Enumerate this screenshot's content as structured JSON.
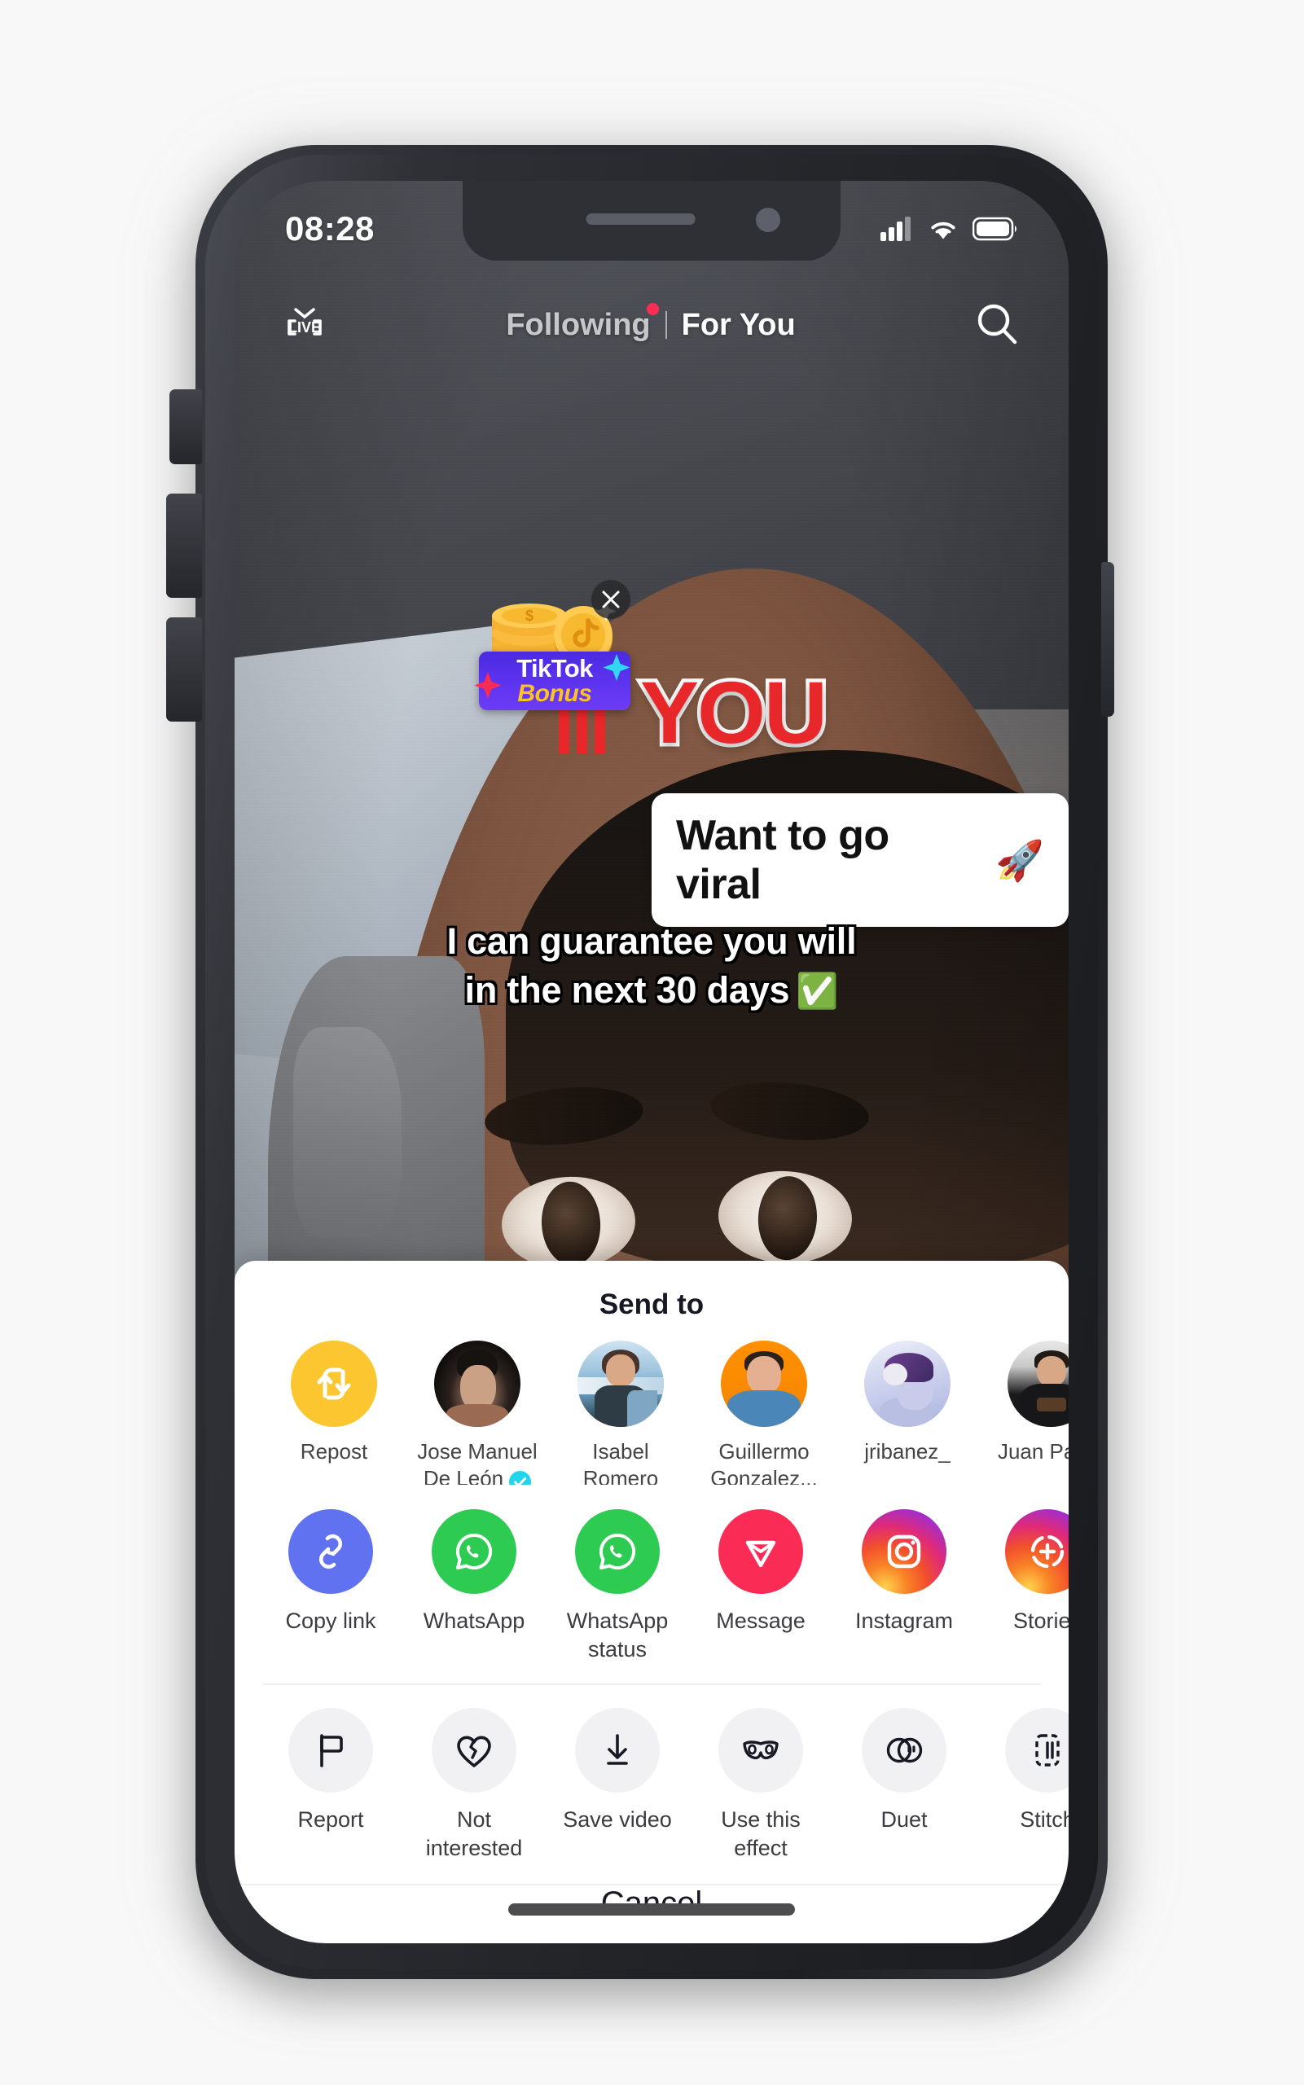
{
  "status_bar": {
    "time": "08:28",
    "cellular_icon": "signal-bars-icon",
    "wifi_icon": "wifi-icon",
    "battery_icon": "battery-icon"
  },
  "top_nav": {
    "live_label": "LIVE",
    "live_icon": "live-tv-icon",
    "tabs": [
      {
        "label": "Following",
        "active": false,
        "has_dot": true
      },
      {
        "label": "For You",
        "active": true,
        "has_dot": false
      }
    ],
    "search_icon": "search-icon"
  },
  "video": {
    "bonus_badge": {
      "line1": "TikTok",
      "line2": "Bonus",
      "coins_icon": "coin-stack-icon",
      "close_icon": "close-icon"
    },
    "overlay_word": "YOU",
    "caption": {
      "text": "Want to go viral",
      "emoji": "🚀"
    },
    "subtitles": [
      {
        "text": "I can guarantee you will",
        "emoji": ""
      },
      {
        "text": "in the next 30 days",
        "emoji": "✅"
      }
    ],
    "profile_avatar_icon": "profile-avatar"
  },
  "share_sheet": {
    "title": "Send to",
    "contacts": [
      {
        "label": "Repost",
        "type": "repost",
        "icon": "repost-icon",
        "verified": false
      },
      {
        "label_line1": "Jose Manuel",
        "label_line2": "De León",
        "type": "avatar",
        "avatar": "av-jose",
        "verified": true
      },
      {
        "label_line1": "Isabel",
        "label_line2": "Romero",
        "type": "avatar",
        "avatar": "av-isabel",
        "verified": false
      },
      {
        "label_line1": "Guillermo",
        "label_line2": "Gonzalez...",
        "type": "avatar",
        "avatar": "av-guille",
        "verified": false
      },
      {
        "label_line1": "jribanez_",
        "label_line2": "",
        "type": "avatar",
        "avatar": "av-jrib",
        "verified": false
      },
      {
        "label_line1": "Juan Pablo",
        "label_line2": "",
        "type": "avatar",
        "avatar": "av-juan",
        "verified": false
      }
    ],
    "apps": [
      {
        "label": "Copy link",
        "icon": "link-icon",
        "color": "#6072f0"
      },
      {
        "label": "WhatsApp",
        "icon": "whatsapp-icon",
        "color": "#2ecb53"
      },
      {
        "label_line1": "WhatsApp",
        "label_line2": "status",
        "icon": "whatsapp-icon",
        "color": "#2ecb53"
      },
      {
        "label": "Message",
        "icon": "tiktok-message-icon",
        "color": "#fa2c55"
      },
      {
        "label": "Instagram",
        "icon": "instagram-icon",
        "color": "#e02a78"
      },
      {
        "label": "Stories",
        "icon": "instagram-stories-icon",
        "color": "#e02a78"
      }
    ],
    "actions": [
      {
        "label": "Report",
        "icon": "flag-icon"
      },
      {
        "label_line1": "Not",
        "label_line2": "interested",
        "icon": "broken-heart-icon"
      },
      {
        "label": "Save video",
        "icon": "download-icon"
      },
      {
        "label_line1": "Use this",
        "label_line2": "effect",
        "icon": "effect-mask-icon"
      },
      {
        "label": "Duet",
        "icon": "duet-icon"
      },
      {
        "label": "Stitch",
        "icon": "stitch-icon"
      }
    ],
    "cancel_label": "Cancel"
  },
  "theme": {
    "accent_red": "#fe2c55",
    "repost_yellow": "#fbc62f",
    "verified_blue": "#20d5ec",
    "whatsapp_green": "#2ecb53",
    "copylink_blue": "#6072f0"
  }
}
